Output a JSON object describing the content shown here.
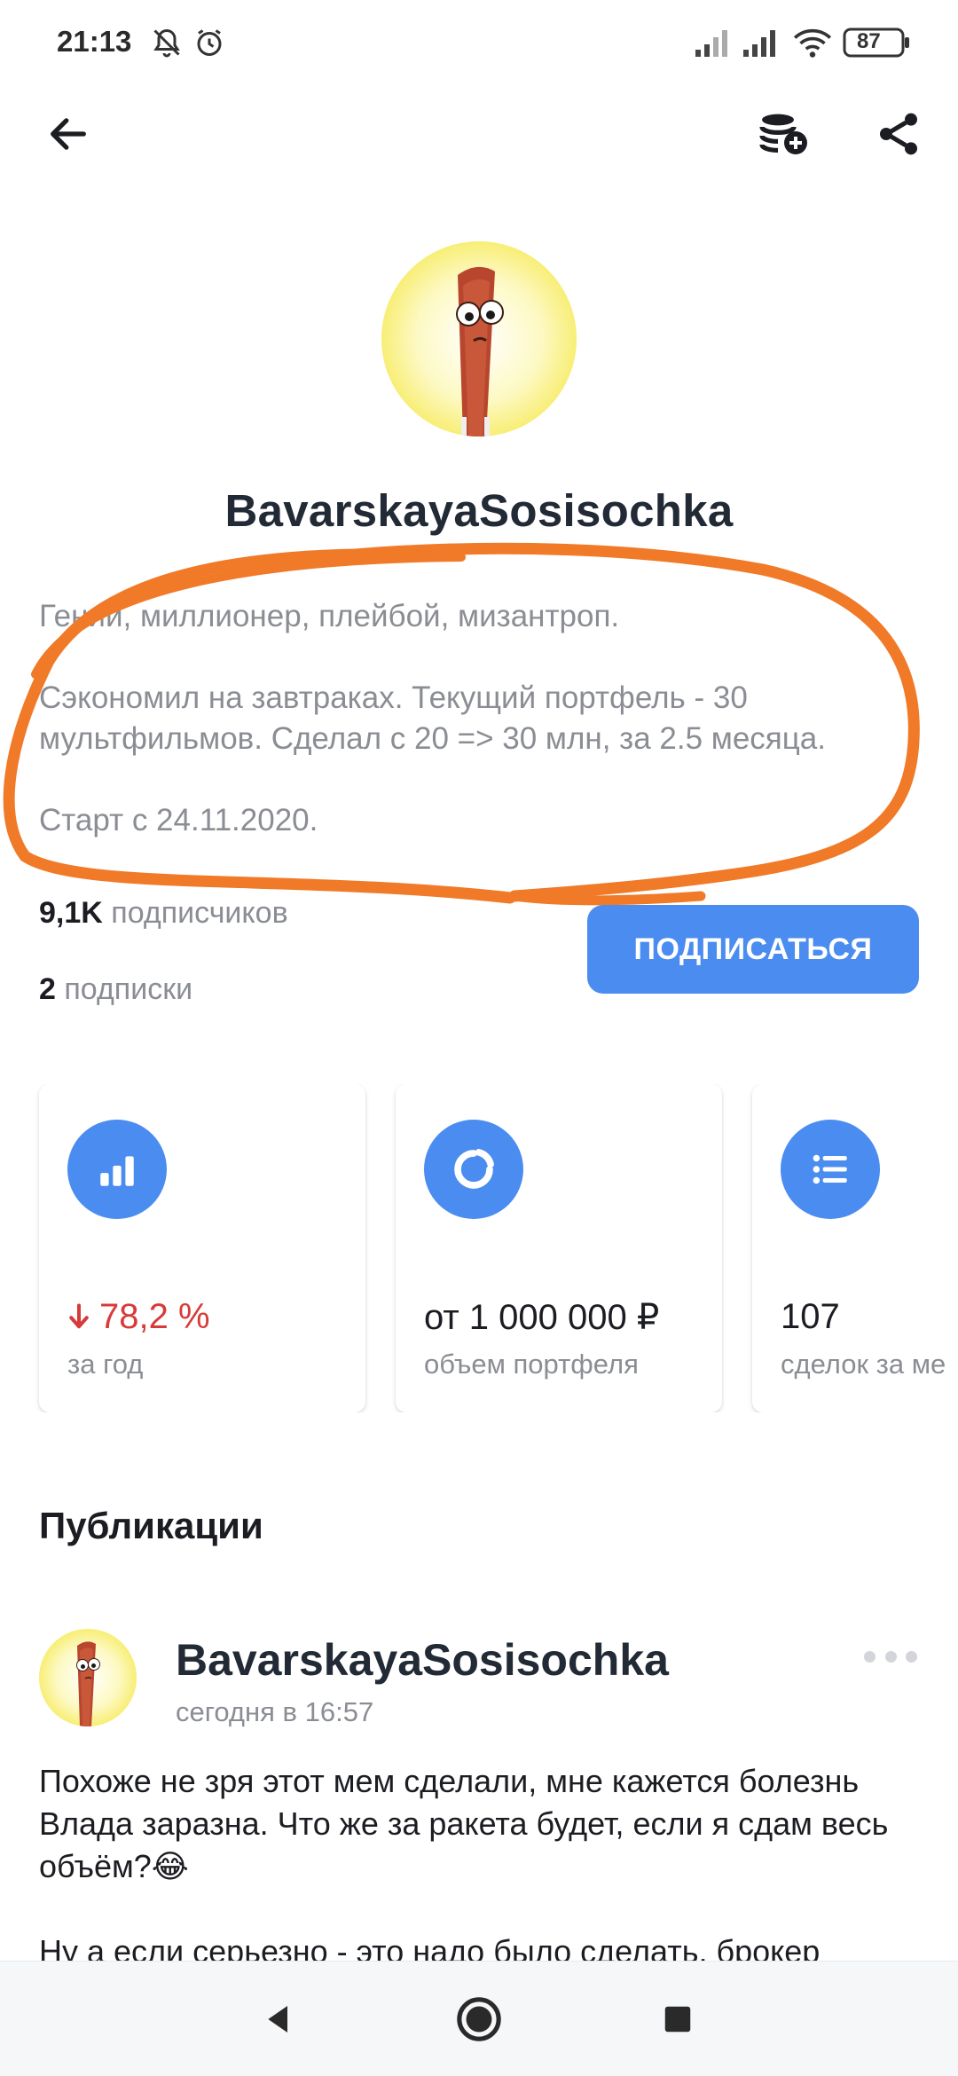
{
  "status_bar": {
    "time": "21:13",
    "battery": "87",
    "icons": [
      "bell-off-icon",
      "alarm-icon",
      "signal-icon",
      "signal-icon",
      "wifi-icon",
      "battery-icon"
    ]
  },
  "top_bar": {
    "back_icon": "arrow-left-icon",
    "add_portfolio_icon": "coins-plus-icon",
    "share_icon": "share-icon"
  },
  "profile": {
    "username": "BavarskayaSosisochka",
    "bio": [
      "Гений, миллионер, плейбой, мизантроп.",
      "Сэкономил на завтраках. Текущий портфель - 30 мультфильмов. Сделал с 20 => 30 млн, за 2.5 месяца.",
      "Старт с 24.11.2020."
    ],
    "followers_count": "9,1K",
    "followers_label": "подписчиков",
    "following_count": "2",
    "following_label": "подписки",
    "subscribe_label": "ПОДПИСАТЬСЯ",
    "annotation_color": "#f07a28"
  },
  "stats": [
    {
      "icon": "bar-chart-icon",
      "value": "78,2 %",
      "direction": "down",
      "label": "за год",
      "color": "#d83a3a"
    },
    {
      "icon": "pie-chart-icon",
      "value": "от 1 000 000 ₽",
      "label": "объем портфеля"
    },
    {
      "icon": "list-icon",
      "value": "107",
      "label": "сделок за ме"
    }
  ],
  "publications": {
    "title": "Публикации",
    "post": {
      "author": "BavarskayaSosisochka",
      "time": "сегодня в 16:57",
      "paragraphs": [
        "Похоже не зря этот мем сделали, мне кажется болезнь Влада заразна. Что же за ракета будет, если я сдам весь объём?😂",
        "Ну а если серьезно - это надо было сделать, брокер"
      ]
    }
  },
  "nav_bar": {
    "back": "triangle-back-icon",
    "home": "circle-home-icon",
    "recents": "square-recents-icon"
  },
  "colors": {
    "accent": "#4a8cf0",
    "negative": "#d83a3a",
    "muted_text": "#8a8d93"
  }
}
